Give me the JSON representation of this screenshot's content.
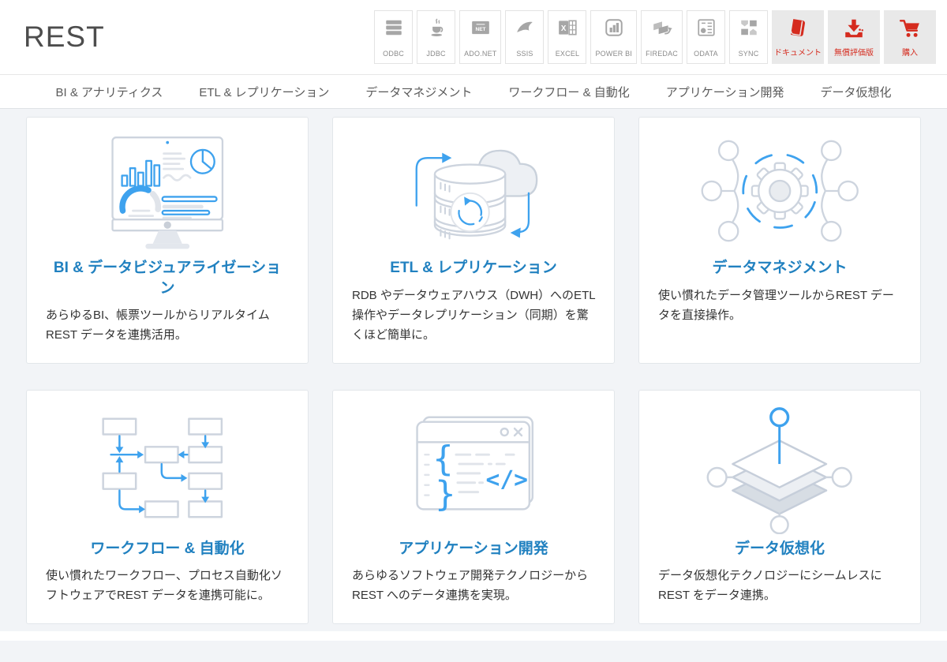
{
  "header": {
    "logo": "REST",
    "tech_links": [
      {
        "label": "ODBC"
      },
      {
        "label": "JDBC"
      },
      {
        "label": "ADO.NET"
      },
      {
        "label": "SSIS"
      },
      {
        "label": "EXCEL"
      },
      {
        "label": "POWER BI"
      },
      {
        "label": "FIREDAC"
      },
      {
        "label": "ODATA"
      },
      {
        "label": "SYNC"
      }
    ],
    "action_buttons": [
      {
        "label": "ドキュメント",
        "icon": "book-icon"
      },
      {
        "label": "無償評価版",
        "icon": "download-icon"
      },
      {
        "label": "購入",
        "icon": "cart-icon"
      }
    ]
  },
  "nav": {
    "items": [
      {
        "label": "BI & アナリティクス"
      },
      {
        "label": "ETL & レプリケーション"
      },
      {
        "label": "データマネジメント"
      },
      {
        "label": "ワークフロー & 自動化"
      },
      {
        "label": "アプリケーション開発"
      },
      {
        "label": "データ仮想化"
      }
    ]
  },
  "cards": [
    {
      "title": "BI & データビジュアライゼーション",
      "body": "あらゆるBI、帳票ツールからリアルタイムREST データを連携活用。"
    },
    {
      "title": "ETL & レプリケーション",
      "body": "RDB やデータウェアハウス（DWH）へのETL 操作やデータレプリケーション（同期）を驚くほど簡単に。"
    },
    {
      "title": "データマネジメント",
      "body": "使い慣れたデータ管理ツールからREST データを直接操作。"
    },
    {
      "title": "ワークフロー & 自動化",
      "body": "使い慣れたワークフロー、プロセス自動化ソフトウェアでREST データを連携可能に。"
    },
    {
      "title": "アプリケーション開発",
      "body": "あらゆるソフトウェア開発テクノロジーからREST へのデータ連携を実現。"
    },
    {
      "title": "データ仮想化",
      "body": "データ仮想化テクノロジーにシームレスにREST をデータ連携。"
    }
  ],
  "colors": {
    "accent_red": "#d52b1e",
    "accent_blue": "#3ea2ee",
    "title_blue": "#2181c0",
    "page_bg": "#f2f4f7"
  }
}
